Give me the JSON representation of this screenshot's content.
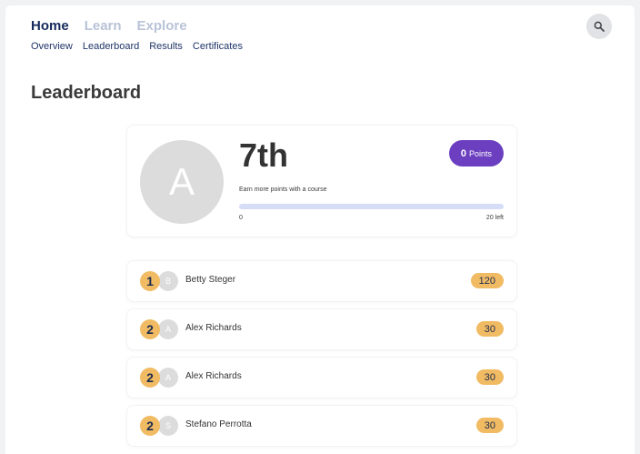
{
  "nav": {
    "tabs": [
      {
        "label": "Home",
        "active": true
      },
      {
        "label": "Learn",
        "active": false
      },
      {
        "label": "Explore",
        "active": false
      }
    ],
    "subtabs": [
      "Overview",
      "Leaderboard",
      "Results",
      "Certificates"
    ],
    "search_icon": "search-icon"
  },
  "page": {
    "title": "Leaderboard"
  },
  "summary": {
    "avatar_letter": "A",
    "rank": "7th",
    "points_value": "0",
    "points_label": "Points",
    "earn_text": "Earn more points with a course",
    "progress_fraction": 0,
    "progress_start": "0",
    "progress_left": "20 left"
  },
  "leaderboard": [
    {
      "position": "1",
      "avatar_letter": "B",
      "name": "Betty Steger",
      "score": "120"
    },
    {
      "position": "2",
      "avatar_letter": "A",
      "name": "Alex Richards",
      "score": "30"
    },
    {
      "position": "2",
      "avatar_letter": "A",
      "name": "Alex Richards",
      "score": "30"
    },
    {
      "position": "2",
      "avatar_letter": "S",
      "name": "Stefano Perrotta",
      "score": "30"
    }
  ],
  "colors": {
    "accent": "#6b3fbf",
    "badge": "#f1bb63",
    "nav_active": "#152a5c",
    "nav_inactive": "#b9c3d8"
  }
}
